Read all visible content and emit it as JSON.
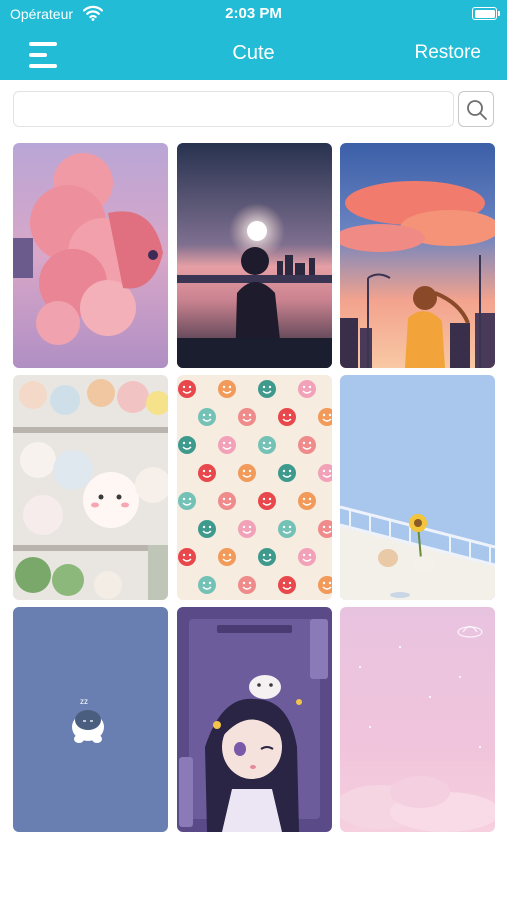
{
  "status_bar": {
    "carrier": "Opérateur",
    "time": "2:03 PM"
  },
  "nav": {
    "title": "Cute",
    "restore_label": "Restore"
  },
  "search": {
    "placeholder": "",
    "value": ""
  },
  "colors": {
    "accent": "#22bcd6",
    "background": "#ffffff"
  },
  "wallpapers": [
    {
      "name": "pink-cloud-girl"
    },
    {
      "name": "sunset-silhouette-girl"
    },
    {
      "name": "city-sunset-girl"
    },
    {
      "name": "plush-toys-shelf"
    },
    {
      "name": "smiley-faces-pattern"
    },
    {
      "name": "sunflower-bridge-cats"
    },
    {
      "name": "sleeping-snorlax"
    },
    {
      "name": "anime-girl-purple"
    },
    {
      "name": "pink-sky-clouds"
    }
  ]
}
